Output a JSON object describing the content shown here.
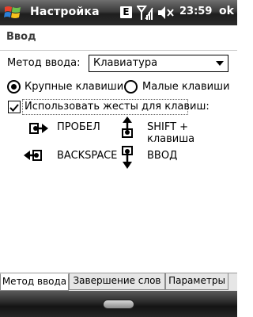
{
  "titlebar": {
    "app_title": "Настройка",
    "network_badge": "E",
    "clock": "23:59",
    "ok_label": "ok",
    "icons": [
      "windows-start-icon",
      "signal-strength-icon",
      "volume-muted-icon"
    ]
  },
  "page": {
    "title": "Ввод"
  },
  "input_method": {
    "label": "Метод ввода:",
    "selected": "Клавиатура"
  },
  "key_size": {
    "large_label": "Крупные клавиши",
    "small_label": "Малые клавиши",
    "selected": "large"
  },
  "gestures": {
    "checkbox_label": "Использовать жесты для клавиш:",
    "checked": true,
    "items": [
      {
        "icon": "gesture-right-icon",
        "label": "ПРОБЕЛ"
      },
      {
        "icon": "gesture-up-icon",
        "label": "SHIFT +",
        "label2": "клавиша"
      },
      {
        "icon": "gesture-left-icon",
        "label": "BACKSPACE"
      },
      {
        "icon": "gesture-down-icon",
        "label": "ВВОД"
      }
    ]
  },
  "tabs": [
    {
      "label": "Метод ввода",
      "active": true
    },
    {
      "label": "Завершение слов",
      "active": false
    },
    {
      "label": "Параметры",
      "active": false
    }
  ],
  "colors": {
    "titlebar": "#2b2b2b",
    "text": "#000000",
    "tab_bg": "#e6e6e6"
  }
}
